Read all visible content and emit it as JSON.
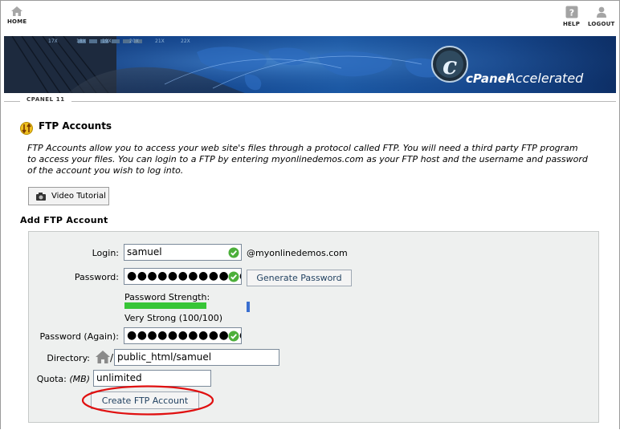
{
  "nav": {
    "home_label": "HOME",
    "help_label": "HELP",
    "logout_label": "LOGOUT"
  },
  "banner": {
    "logo_letter": "c",
    "brand": "cPanel",
    "tagline": "Accelerated"
  },
  "tabstrip": {
    "tab_label": "CPANEL 11"
  },
  "page": {
    "title": "FTP Accounts",
    "description": "FTP Accounts allow you to access your web site's files through a protocol called FTP. You will need a third party FTP program to access your files. You can login to a FTP by entering myonlinedemos.com as your FTP host and the username and password of the account you wish to log into.",
    "video_button": "Video Tutorial",
    "section_title": "Add FTP Account"
  },
  "form": {
    "login_label": "Login:",
    "login_value": "samuel",
    "domain_suffix": "@myonlinedemos.com",
    "password_label": "Password:",
    "password_value": "●●●●●●●●●●●●●",
    "generate_button": "Generate Password",
    "strength_label": "Password Strength:",
    "strength_fraction": 1.0,
    "strength_text": "Very Strong (100/100)",
    "password_again_label": "Password (Again):",
    "password_again_value": "●●●●●●●●●●●●●",
    "directory_label": "Directory:",
    "directory_slash": "/",
    "directory_value": "public_html/samuel",
    "quota_label": "Quota:",
    "quota_unit": "(MB)",
    "quota_value": "unlimited",
    "create_button": "Create FTP Account"
  },
  "colors": {
    "valid_check": "#4caf3a",
    "strength_bar": "#37c537",
    "highlight_ellipse": "#e01010"
  }
}
